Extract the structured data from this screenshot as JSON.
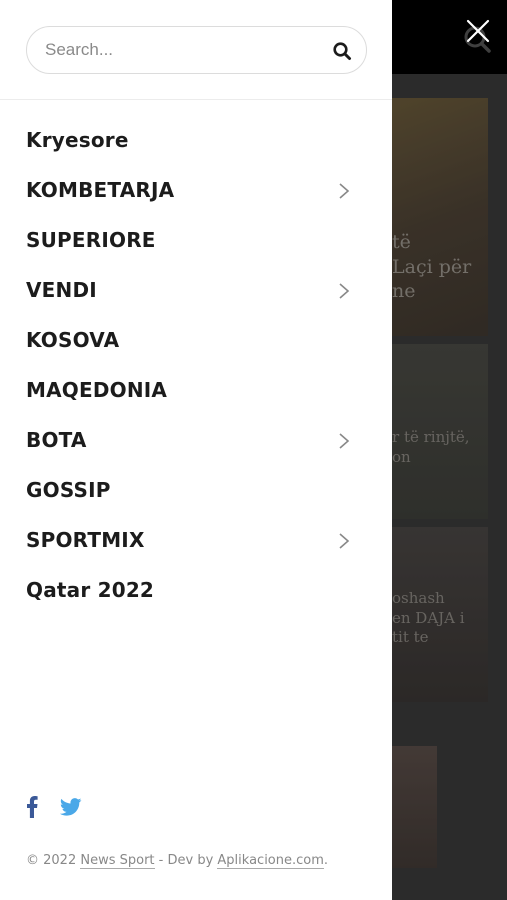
{
  "search": {
    "placeholder": "Search..."
  },
  "menu": {
    "items": [
      {
        "label": "Kryesore",
        "has_submenu": false
      },
      {
        "label": "KOMBETARJA",
        "has_submenu": true
      },
      {
        "label": "SUPERIORE",
        "has_submenu": false
      },
      {
        "label": "VENDI",
        "has_submenu": true
      },
      {
        "label": "KOSOVA",
        "has_submenu": false
      },
      {
        "label": "MAQEDONIA",
        "has_submenu": false
      },
      {
        "label": "BOTA",
        "has_submenu": true
      },
      {
        "label": "GOSSIP",
        "has_submenu": false
      },
      {
        "label": "SPORTMIX",
        "has_submenu": true
      },
      {
        "label": "Qatar 2022",
        "has_submenu": false
      }
    ]
  },
  "social": {
    "icons": [
      "facebook-icon",
      "twitter-icon"
    ],
    "facebook_color": "#3b5998",
    "twitter_color": "#4aa8e8"
  },
  "footer": {
    "prefix": "© 2022 ",
    "site_link": "News Sport",
    "middle": " - Dev by ",
    "dev_link": "Aplikacione.com",
    "suffix": "."
  },
  "background": {
    "cards": [
      {
        "text": "të\nLaçi për\nne"
      },
      {
        "text": "r të rinjtë,\non"
      },
      {
        "text": "oshash\nen DAJA i\ntit te"
      }
    ]
  }
}
